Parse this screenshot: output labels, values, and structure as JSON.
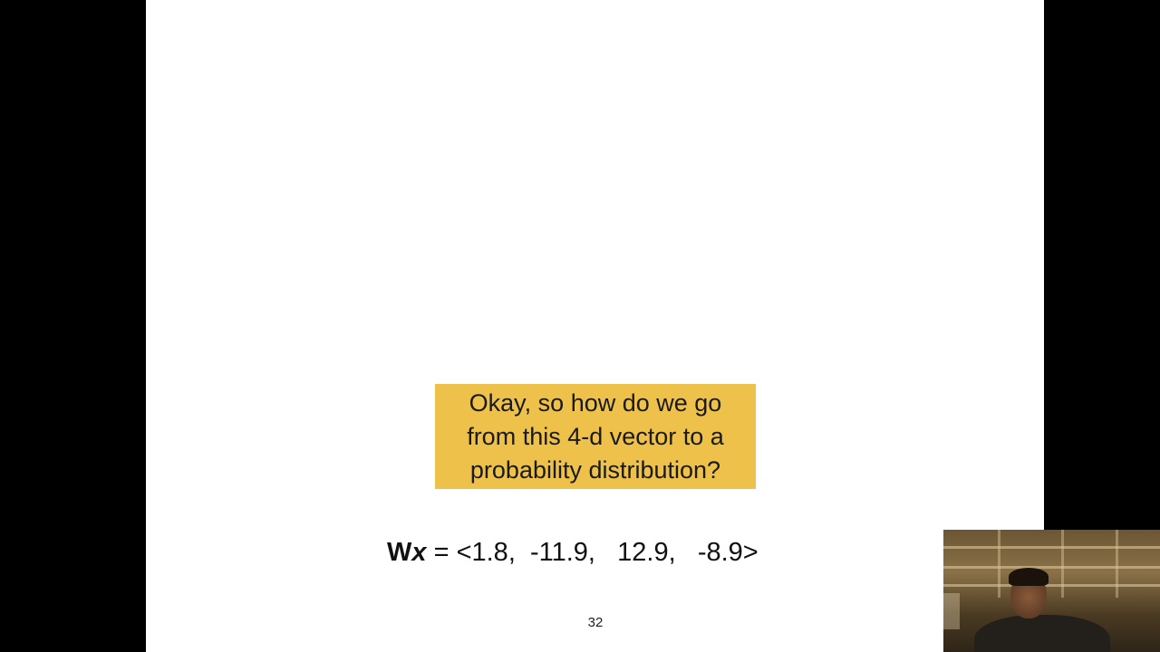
{
  "slide": {
    "background": "#ffffff",
    "callout": {
      "text": "Okay, so how do we go\nfrom this 4-d vector to a\nprobability distribution?",
      "background": "#edc14a"
    },
    "equation": {
      "w": "W",
      "x": "x",
      "rest": " = <1.8,  -11.9,   12.9,   -8.9>"
    },
    "page_number": "32"
  },
  "webcam": {
    "description_icon": "presenter-webcam"
  }
}
